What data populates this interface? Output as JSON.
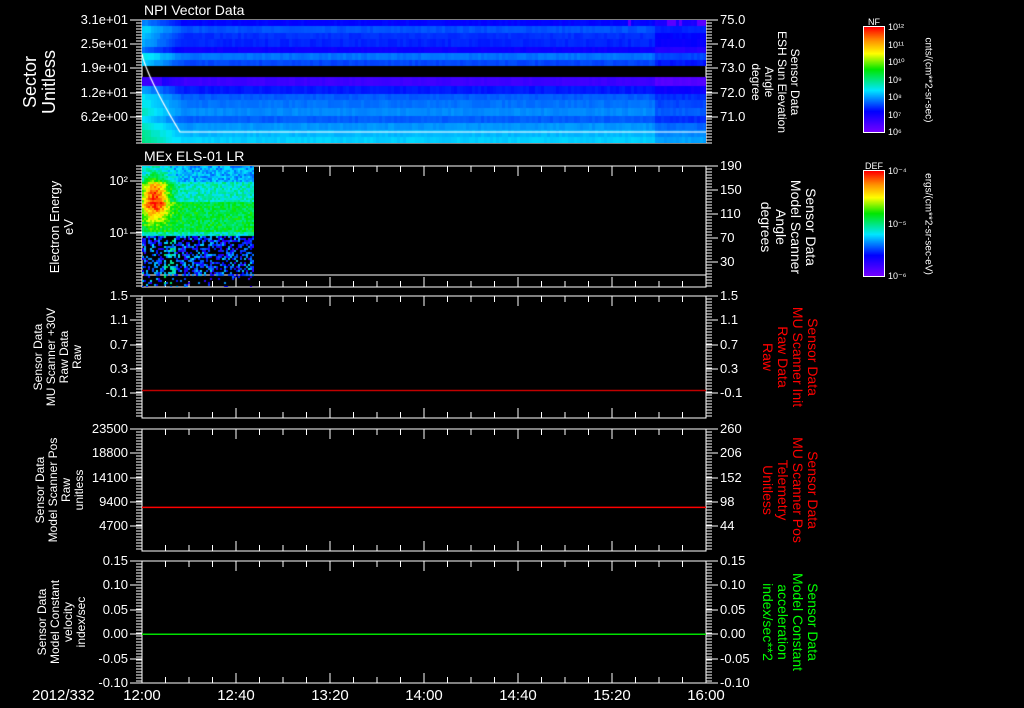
{
  "date_label": "2012/332",
  "time_ticks": [
    "12:00",
    "12:40",
    "13:20",
    "14:00",
    "14:40",
    "15:20",
    "16:00"
  ],
  "colorbars": [
    {
      "title": "NF",
      "labels": [
        "10¹²",
        "10¹¹",
        "10¹⁰",
        "10⁹",
        "10⁸",
        "10⁷",
        "10⁶"
      ],
      "units": "cnts/(cm**2-sr-sec)"
    },
    {
      "title": "DEF",
      "labels": [
        "10⁻⁴",
        "10⁻⁵",
        "10⁻⁶"
      ],
      "units": "ergs/(cm**2-sr-sec-eV)"
    }
  ],
  "chart_data": [
    {
      "type": "heatmap",
      "title": "NPI Vector Data",
      "ylabel": [
        "Sector",
        "Unitless"
      ],
      "yticks": [
        "3.1e+01",
        "2.5e+01",
        "1.9e+01",
        "1.2e+01",
        "6.2e+00"
      ],
      "ylim": [
        0,
        31
      ],
      "right_ylabel": [
        "Sensor Data",
        "ESH Sun Elevation",
        "Angle",
        "degree"
      ],
      "right_yticks": [
        "75.0",
        "74.0",
        "73.0",
        "72.0",
        "71.0"
      ],
      "right_ylim": [
        70,
        75
      ],
      "overlay_line": {
        "color": "#ffffff",
        "start": 74.0,
        "end": 70.4
      }
    },
    {
      "type": "heatmap",
      "title": "MEx ELS-01 LR",
      "ylabel": [
        "Electron Energy",
        "eV"
      ],
      "yticks": [
        "10²",
        "10¹"
      ],
      "yscale": "log",
      "right_ylabel": [
        "Sensor Data",
        "Model Scanner",
        "Angle",
        "degrees"
      ],
      "right_yticks": [
        "190",
        "150",
        "110",
        "70",
        "30"
      ],
      "right_ylim": [
        10,
        190
      ],
      "data_end": "12:48"
    },
    {
      "type": "line",
      "ylabel": [
        "Sensor Data",
        "MU Scanner +30V",
        "Raw Data",
        "Raw"
      ],
      "yticks": [
        "1.5",
        "1.1",
        "0.7",
        "0.3",
        "-0.1"
      ],
      "ylim": [
        -0.5,
        1.5
      ],
      "right_ylabel": [
        "Sensor Data",
        "MU Scanner Init",
        "Raw Data",
        "Raw"
      ],
      "right_label_color": "#ff0000",
      "right_yticks": [
        "1.5",
        "1.1",
        "0.7",
        "0.3",
        "-0.1"
      ],
      "series": [
        {
          "value": -0.05,
          "color": "#c00000"
        }
      ]
    },
    {
      "type": "line",
      "ylabel": [
        "Sensor Data",
        "Model Scanner Pos",
        "Raw",
        "unitless"
      ],
      "yticks": [
        "23500",
        "18800",
        "14100",
        "9400",
        "4700"
      ],
      "ylim": [
        0,
        23500
      ],
      "right_ylabel": [
        "Sensor Data",
        "MU Scanner Pos",
        "Telemetry",
        "Unitless"
      ],
      "right_label_color": "#ff0000",
      "right_yticks": [
        "260",
        "206",
        "152",
        "98",
        "44"
      ],
      "series": [
        {
          "value": 8400,
          "color": "#ff0000"
        }
      ]
    },
    {
      "type": "line",
      "ylabel": [
        "Sensor Data",
        "Model Constant",
        "velocity",
        "index/sec"
      ],
      "yticks": [
        "0.15",
        "0.10",
        "0.05",
        "0.00",
        "-0.05",
        "-0.10"
      ],
      "ylim": [
        -0.1,
        0.15
      ],
      "right_ylabel": [
        "Sensor Data",
        "Model Constant",
        "acceleration",
        "index/sec**2"
      ],
      "right_label_color": "#00ff00",
      "right_yticks": [
        "0.15",
        "0.10",
        "0.05",
        "0.00",
        "-0.05",
        "-0.10"
      ],
      "series": [
        {
          "value": 0.0,
          "color": "#00e000"
        }
      ]
    }
  ]
}
